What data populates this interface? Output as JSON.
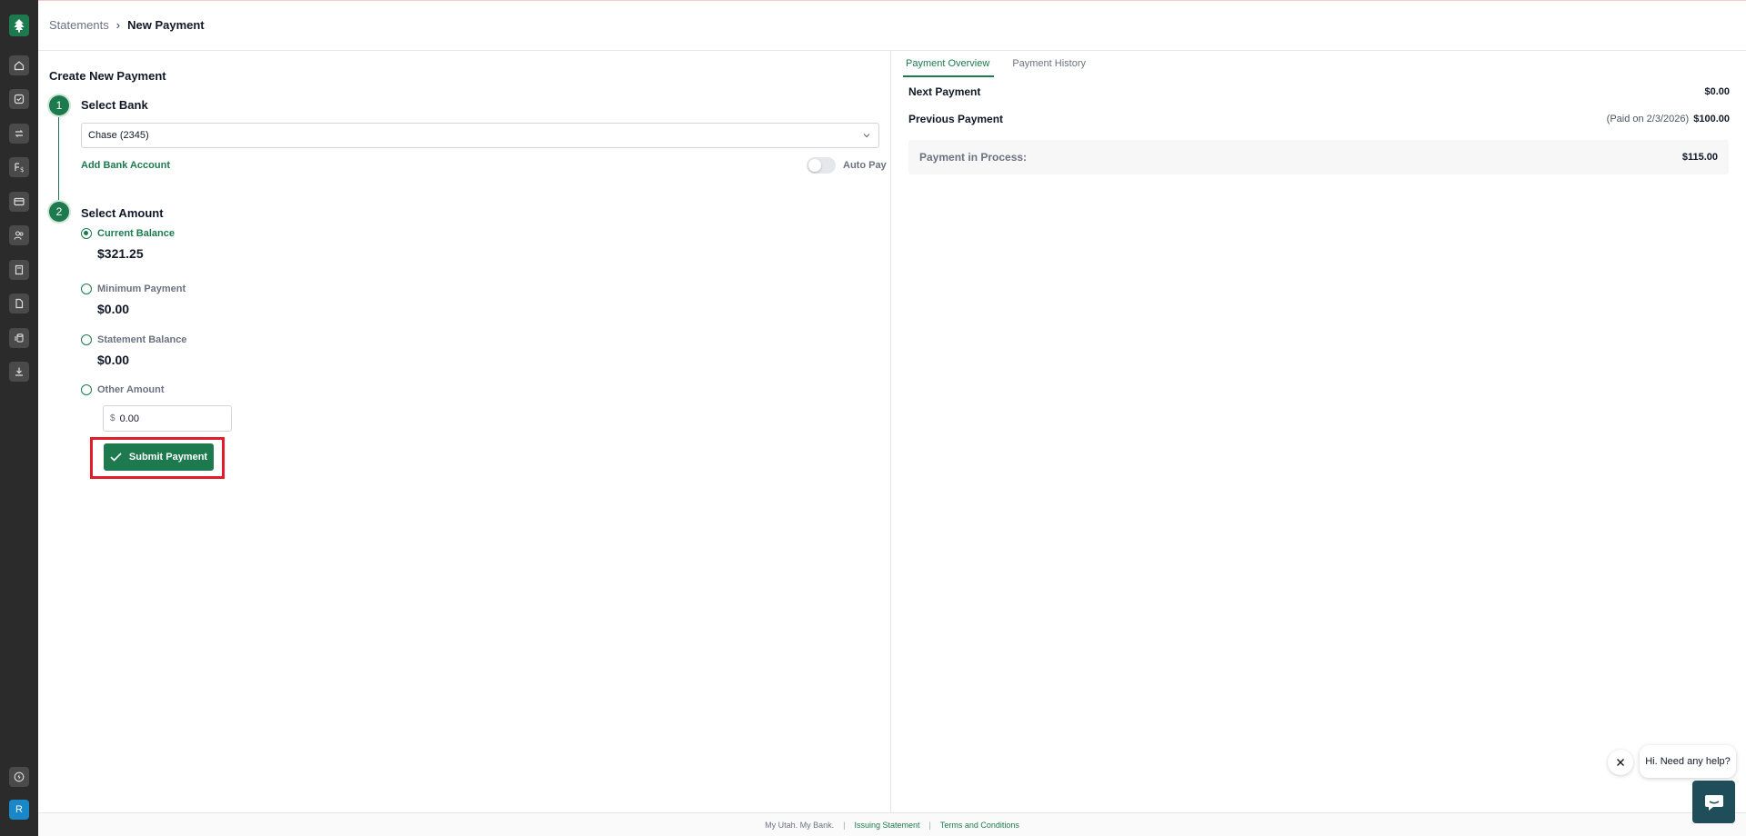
{
  "breadcrumb": {
    "parent": "Statements",
    "separator": "›",
    "current": "New Payment"
  },
  "form": {
    "title": "Create New Payment",
    "step1": {
      "number": "1",
      "title": "Select Bank",
      "selected_bank": "Chase (2345)",
      "add_bank_label": "Add Bank Account",
      "autopay_label": "Auto Pay",
      "autopay_on": false
    },
    "step2": {
      "number": "2",
      "title": "Select Amount",
      "options": [
        {
          "label": "Current Balance",
          "amount": "$321.25",
          "selected": true
        },
        {
          "label": "Minimum Payment",
          "amount": "$0.00",
          "selected": false
        },
        {
          "label": "Statement Balance",
          "amount": "$0.00",
          "selected": false
        },
        {
          "label": "Other Amount",
          "selected": false
        }
      ],
      "other_currency": "$",
      "other_value": "0.00"
    },
    "submit_label": "Submit Payment"
  },
  "overview": {
    "tabs": [
      {
        "label": "Payment Overview",
        "active": true
      },
      {
        "label": "Payment History",
        "active": false
      }
    ],
    "next_payment": {
      "label": "Next Payment",
      "value": "$0.00"
    },
    "previous_payment": {
      "label": "Previous Payment",
      "note": "(Paid on 2/3/2026)",
      "value": "$100.00"
    },
    "in_process": {
      "label": "Payment in Process:",
      "value": "$115.00"
    }
  },
  "footer": {
    "tagline": "My Utah. My Bank.",
    "link1": "Issuing Statement",
    "link2": "Terms and Conditions",
    "separator": "|"
  },
  "chat": {
    "greeting": "Hi. Need any help?"
  },
  "user": {
    "initial": "R"
  },
  "colors": {
    "brand": "#1d7a4e",
    "sidebar": "#2b2b2b",
    "highlight": "#e11d2a",
    "chat": "#1f4d5a",
    "avatar": "#1a87c9"
  }
}
